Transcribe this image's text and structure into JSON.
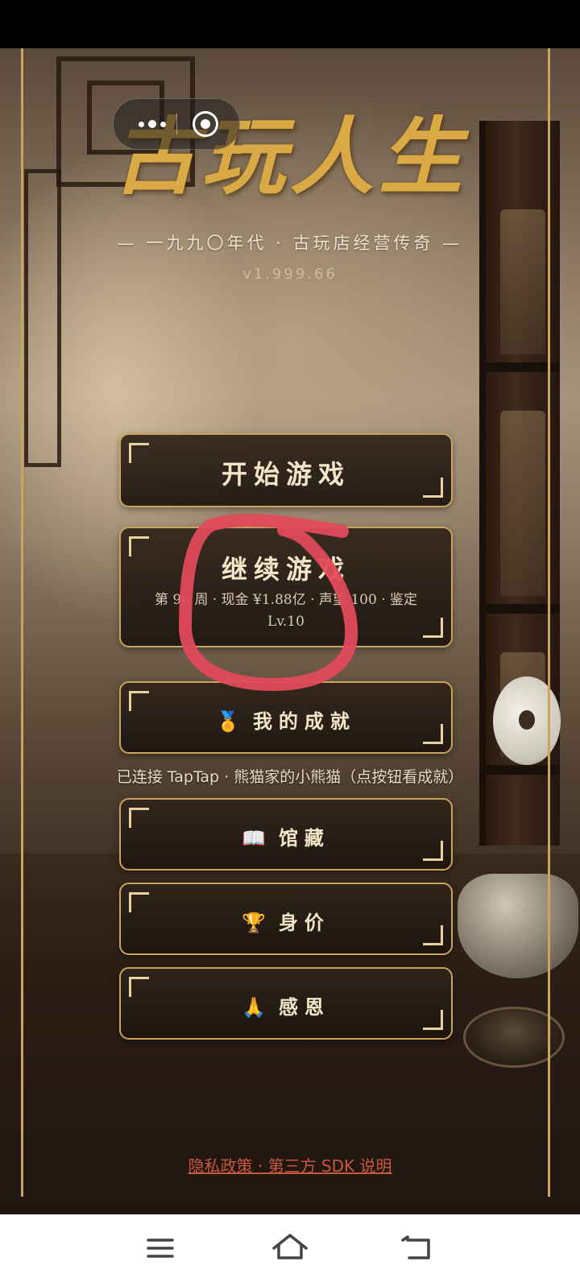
{
  "game": {
    "title": "古玩人生",
    "subtitle": "— 一九九〇年代 · 古玩店经营传奇 —",
    "version": "v1.999.66"
  },
  "menu": {
    "start": "开始游戏",
    "continue": "继续游戏",
    "save_info": "第 96 周 · 现金 ¥1.88亿 · 声望 100 · 鉴定 Lv.10",
    "achievements": "我的成就",
    "achievements_icon": "🏅",
    "collection": "馆藏",
    "collection_icon": "📖",
    "net_worth": "身价",
    "net_worth_icon": "🏆",
    "thanks": "感恩",
    "thanks_icon": "🙏"
  },
  "taptap_status": "已连接 TapTap · 熊猫家的小熊猫（点按钮看成就）",
  "footer": {
    "links": "隐私政策 · 第三方 SDK 说明"
  },
  "colors": {
    "gold": "#c9a45e",
    "title_gold": "#d9a946",
    "link_red": "#c9563e",
    "annotation_red": "#e04a5a"
  },
  "icons": {
    "capsule_more": "more-dots-icon",
    "capsule_close": "close-miniprogram-icon",
    "nav_menu": "menu-icon",
    "nav_home": "home-icon",
    "nav_back": "back-icon"
  }
}
